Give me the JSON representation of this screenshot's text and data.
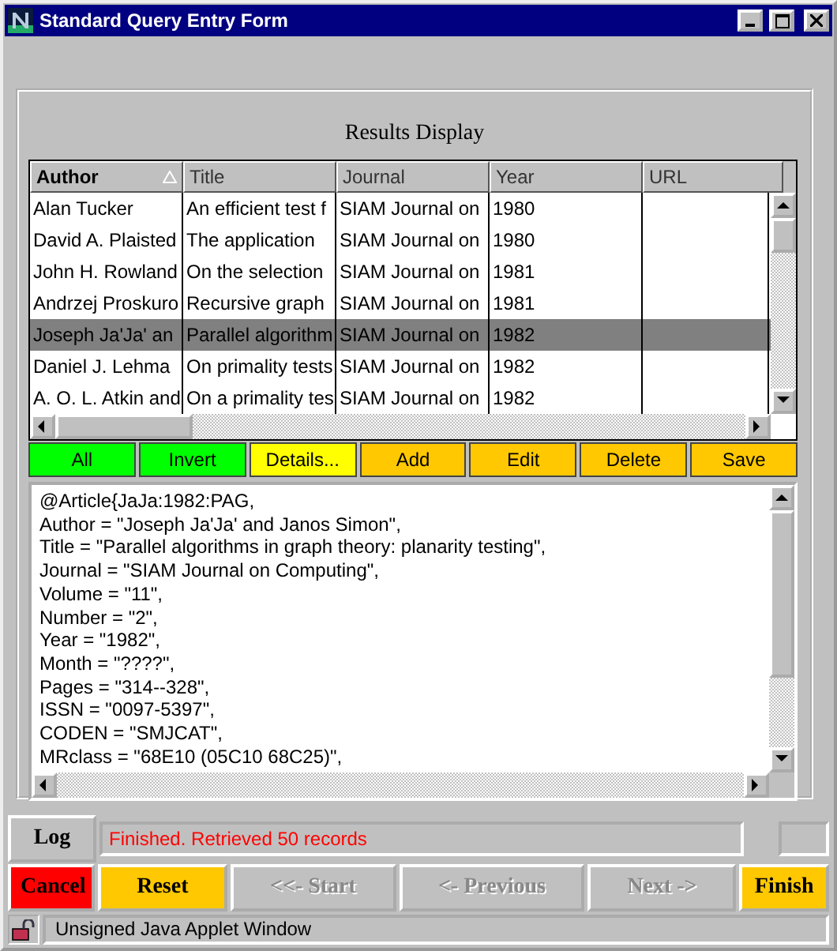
{
  "window": {
    "title": "Standard Query Entry Form"
  },
  "results": {
    "title": "Results Display",
    "columns": [
      {
        "label": "Author",
        "sorted": true
      },
      {
        "label": "Title",
        "sorted": false
      },
      {
        "label": "Journal",
        "sorted": false
      },
      {
        "label": "Year",
        "sorted": false
      },
      {
        "label": "URL",
        "sorted": false
      }
    ],
    "rows": [
      {
        "cells": [
          "Alan Tucker",
          "An efficient test f",
          "SIAM Journal on",
          "1980",
          ""
        ],
        "selected": false
      },
      {
        "cells": [
          "David A. Plaisted",
          "The application",
          "SIAM Journal on",
          "1980",
          ""
        ],
        "selected": false
      },
      {
        "cells": [
          "John H. Rowland",
          "On the selection",
          "SIAM Journal on",
          "1981",
          ""
        ],
        "selected": false
      },
      {
        "cells": [
          "Andrzej Proskuro",
          "Recursive graph",
          "SIAM Journal on",
          "1981",
          ""
        ],
        "selected": false
      },
      {
        "cells": [
          "Joseph Ja'Ja' an",
          "Parallel algorithm",
          "SIAM Journal on",
          "1982",
          ""
        ],
        "selected": true
      },
      {
        "cells": [
          "Daniel J. Lehma",
          "On primality tests",
          "SIAM Journal on",
          "1982",
          ""
        ],
        "selected": false
      },
      {
        "cells": [
          "A. O. L. Atkin and",
          "On a primality tes",
          "SIAM Journal on",
          "1982",
          ""
        ],
        "selected": false
      }
    ],
    "actions": [
      {
        "label": "All",
        "color": "#00ff00"
      },
      {
        "label": "Invert",
        "color": "#00ff00"
      },
      {
        "label": "Details...",
        "color": "#ffff00"
      },
      {
        "label": "Add",
        "color": "#ffc800"
      },
      {
        "label": "Edit",
        "color": "#ffc800"
      },
      {
        "label": "Delete",
        "color": "#ffc800"
      },
      {
        "label": "Save",
        "color": "#ffc800"
      }
    ],
    "details": [
      "@Article{JaJa:1982:PAG,",
      "Author = \"Joseph Ja'Ja' and Janos Simon\",",
      "Title = \"Parallel algorithms in graph theory: planarity testing\",",
      "Journal = \"SIAM Journal on Computing\",",
      "Volume = \"11\",",
      "Number = \"2\",",
      "Year = \"1982\",",
      "Month = \"????\",",
      "Pages = \"314--328\",",
      "ISSN = \"0097-5397\",",
      "CODEN = \"SMJCAT\",",
      "MRclass = \"68E10 (05C10 68C25)\","
    ]
  },
  "log_button": "Log",
  "status_message": "Finished. Retrieved 50 records",
  "nav_buttons": [
    {
      "label": "Cancel",
      "color": "#ff0000",
      "disabled": false
    },
    {
      "label": "Reset",
      "color": "#ffc800",
      "disabled": false
    },
    {
      "label": "<<- Start",
      "color": "#c0c0c0",
      "disabled": true
    },
    {
      "label": "<- Previous",
      "color": "#c0c0c0",
      "disabled": true
    },
    {
      "label": "Next ->",
      "color": "#c0c0c0",
      "disabled": true
    },
    {
      "label": "Finish",
      "color": "#ffc800",
      "disabled": false
    }
  ],
  "status_bar": "Unsigned Java Applet Window"
}
